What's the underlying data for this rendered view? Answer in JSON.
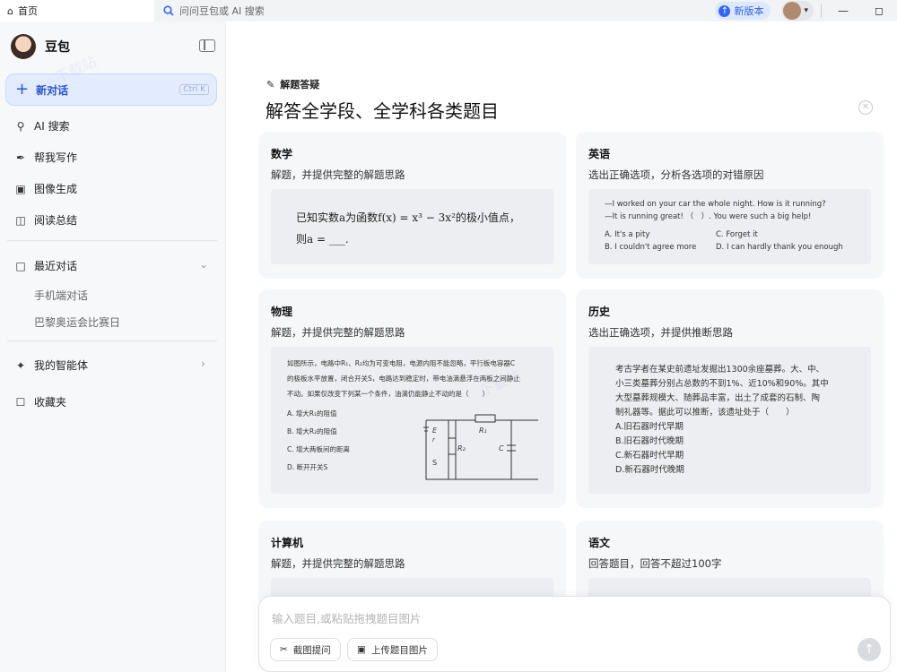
{
  "titlebar": {
    "home_tab": "首页",
    "search_placeholder": "问问豆包或 AI 搜索",
    "new_version": "新版本"
  },
  "sidebar": {
    "brand": "豆包",
    "new_chat": "新对话",
    "new_chat_shortcut": "Ctrl K",
    "nav": [
      {
        "label": "AI 搜索",
        "icon": "ai-search-icon"
      },
      {
        "label": "帮我写作",
        "icon": "pen-icon"
      },
      {
        "label": "图像生成",
        "icon": "image-icon"
      },
      {
        "label": "阅读总结",
        "icon": "book-icon"
      }
    ],
    "recent_title": "最近对话",
    "recent_items": [
      "手机端对话",
      "巴黎奥运会比赛日"
    ],
    "agents": "我的智能体",
    "favorites": "收藏夹"
  },
  "main": {
    "section_label": "解题答疑",
    "headline": "解答全学段、全学科各类题目",
    "cards": {
      "math": {
        "title": "数学",
        "desc": "解题，并提供完整的解题思路",
        "line1": "已知实数a为函数f(x) = x³ − 3x²的极小值点，",
        "line2": "则a = ___."
      },
      "english": {
        "title": "英语",
        "desc": "选出正确选项，分析各选项的对错原因",
        "line1": "—I worked on your car the whole night. How is it running?",
        "line2": "—It is running great! （　）. You were such a big help!",
        "opt_a": "A. It's a pity",
        "opt_c": "C. Forget it",
        "opt_b": "B. I couldn't agree more",
        "opt_d": "D. I can hardly thank you enough"
      },
      "physics": {
        "title": "物理",
        "desc": "解题，并提供完整的解题思路",
        "q1": "如图所示，电路中R₁、R₂均为可变电阻，电源内阻不能忽略，平行板电容器C",
        "q2": "的极板水平放置，闭合开关S，电路达到稳定时，带电油滴悬浮在两板之间静止",
        "q3": "不动。如果仅改变下列某一个条件，油滴仍能静止不动的是（　　）",
        "opt_a": "A. 增大R₁的阻值",
        "opt_b": "B. 增大R₂的阻值",
        "opt_c": "C. 增大两板间的距离",
        "opt_d": "D. 断开开关S",
        "lbl_e": "E",
        "lbl_r": "r",
        "lbl_s": "S",
        "lbl_r1": "R₁",
        "lbl_r2": "R₂",
        "lbl_c": "C"
      },
      "history": {
        "title": "历史",
        "desc": "选出正确选项，并提供推断思路",
        "l1": "考古学者在某史前遗址发掘出1300余座墓葬。大、中、",
        "l2": "小三类墓葬分别占总数的不到1%、近10%和90%。其中",
        "l3": "大型墓葬规模大、随葬品丰富，出土了成套的石制、陶",
        "l4": "制礼器等。据此可以推断，该遗址处于（　　）",
        "opt_a": "A.旧石器时代早期",
        "opt_b": "B.旧石器时代晚期",
        "opt_c": "C.新石器时代早期",
        "opt_d": "D.新石器时代晚期"
      },
      "computer": {
        "title": "计算机",
        "desc": "解题，并提供完整的解题思路"
      },
      "chinese": {
        "title": "语文",
        "desc": "回答题目，回答不超过100字"
      }
    }
  },
  "input": {
    "placeholder": "输入题目,或粘贴拖拽题目图片",
    "screenshot_btn": "截图提问",
    "upload_btn": "上传题目图片"
  }
}
